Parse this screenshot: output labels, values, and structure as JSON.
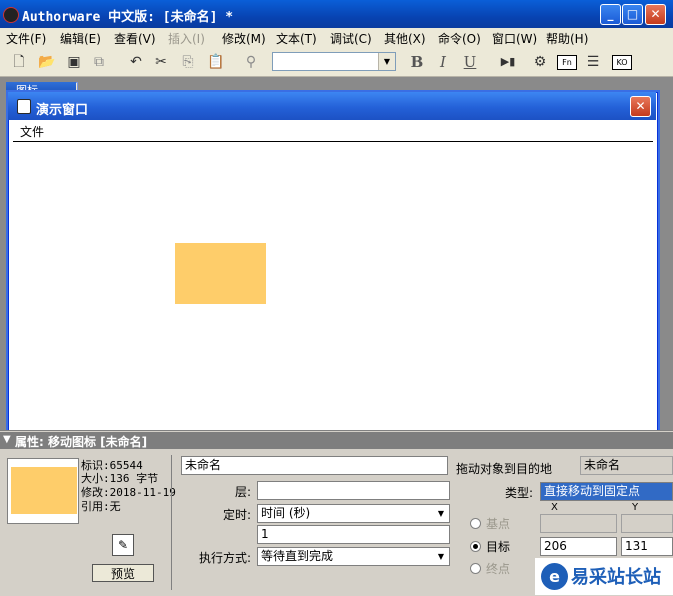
{
  "window": {
    "title": "Authorware 中文版: [未命名] *",
    "minimize": "_",
    "maximize": "□",
    "close": "✕"
  },
  "menu": [
    "文件(F)",
    "编辑(E)",
    "查看(V)",
    "插入(I)",
    "修改(M)",
    "文本(T)",
    "调试(C)",
    "其他(X)",
    "命令(O)",
    "窗口(W)",
    "帮助(H)"
  ],
  "menu_disabled": [
    "插入(I)"
  ],
  "toolbar": {
    "font_value": "",
    "bold": "B",
    "italic": "I",
    "underline": "U",
    "fn_label": "Fn",
    "ko_label": "KO"
  },
  "background_window": {
    "title": "图标"
  },
  "presentation": {
    "title": "演示窗口",
    "menu_file": "文件",
    "close": "✕",
    "object_color": "#fecd6a"
  },
  "properties": {
    "header": "属性: 移动图标 [未命名]",
    "info": {
      "id": "标识:65544",
      "size": "大小:136 字节",
      "modified": "修改:2018-11-19",
      "ref": "引用:无"
    },
    "preview_button": "预览",
    "name_value": "未命名",
    "layer_label": "层:",
    "layer_value": "",
    "timing_label": "定时:",
    "timing_value": "时间 (秒)",
    "timing_amount": "1",
    "exec_label": "执行方式:",
    "exec_value": "等待直到完成",
    "drag_label": "拖动对象到目的地",
    "drag_object": "未命名",
    "type_label": "类型:",
    "type_value": "直接移动到固定点",
    "col_x": "X",
    "col_y": "Y",
    "base_label": "基点",
    "target_label": "目标",
    "end_label": "终点",
    "target_x": "206",
    "target_y": "131"
  },
  "watermark": {
    "logo": "e",
    "text": "易采站长站"
  }
}
